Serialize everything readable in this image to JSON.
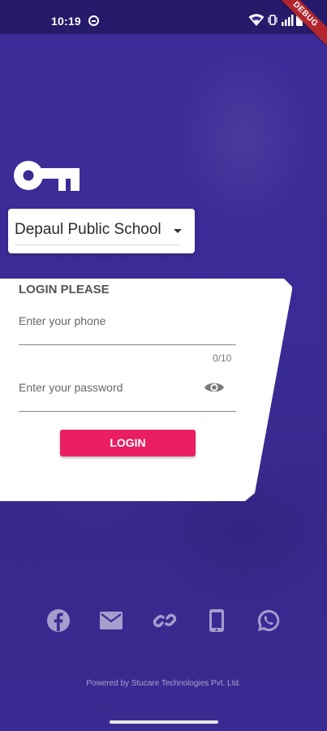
{
  "status_bar": {
    "time": "10:19",
    "icons": [
      "wifi-icon",
      "vibrate-icon",
      "signal-icon",
      "battery-icon"
    ],
    "debug_label": "DEBUG"
  },
  "school_selector": {
    "value": "Depaul Public School",
    "icon": "dropdown-arrow-icon"
  },
  "login": {
    "title": "LOGIN PLEASE",
    "phone_placeholder": "Enter your phone",
    "phone_counter": "0/10",
    "password_placeholder": "Enter your password",
    "button_label": "LOGIN"
  },
  "social": [
    "facebook-icon",
    "mail-icon",
    "link-icon",
    "phone-icon",
    "whatsapp-icon"
  ],
  "footer": {
    "powered_by": "Powered by Stucare Technologies Pvt. Ltd."
  },
  "colors": {
    "background": "#3a2a94",
    "accent": "#e91e63",
    "debug_ribbon": "#b3262d"
  }
}
